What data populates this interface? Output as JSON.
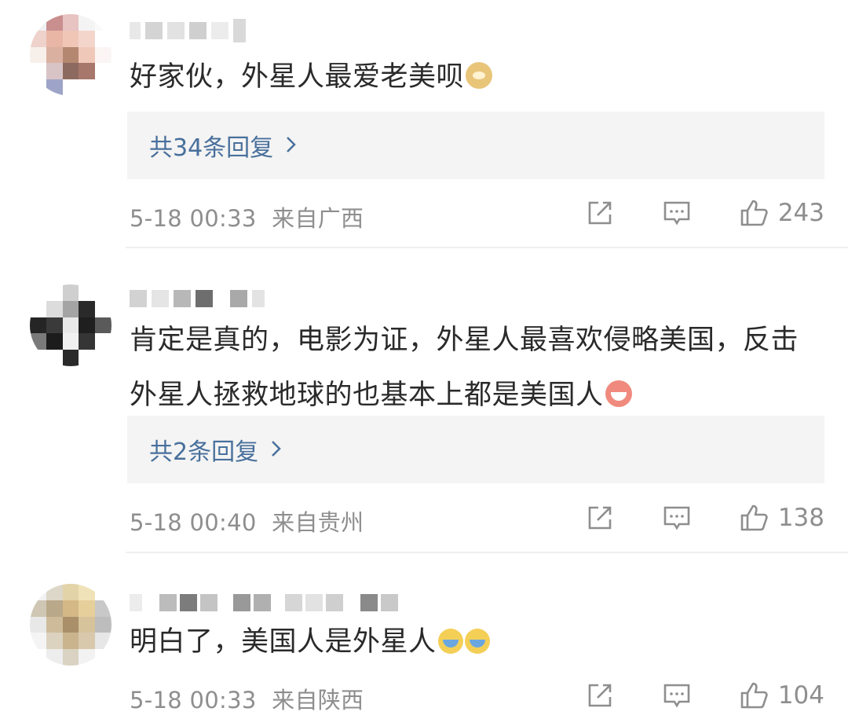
{
  "comments": [
    {
      "text": "好家伙，外星人最爱老美呗",
      "emoji": [
        "doge-emoji"
      ],
      "replies_label": "共34条回复",
      "time": "5-18 00:33",
      "location": "来自广西",
      "likes": "243"
    },
    {
      "text": "肯定是真的，电影为证，外星人最喜欢侵略美国，反击外星人拯救地球的也基本上都是美国人",
      "emoji": [
        "laugh-emoji"
      ],
      "replies_label": "共2条回复",
      "time": "5-18 00:40",
      "location": "来自贵州",
      "likes": "138"
    },
    {
      "text": "明白了，美国人是外星人",
      "emoji": [
        "cry-laugh-emoji",
        "cry-laugh-emoji"
      ],
      "time": "5-18 00:33",
      "location": "来自陕西",
      "likes": "104"
    }
  ],
  "icons": {
    "share": "share-icon",
    "comment": "comment-icon",
    "like": "thumbs-up-icon"
  },
  "colors": {
    "link": "#49709c",
    "meta": "#8e8e8e",
    "reply_bg": "#f4f4f4"
  }
}
